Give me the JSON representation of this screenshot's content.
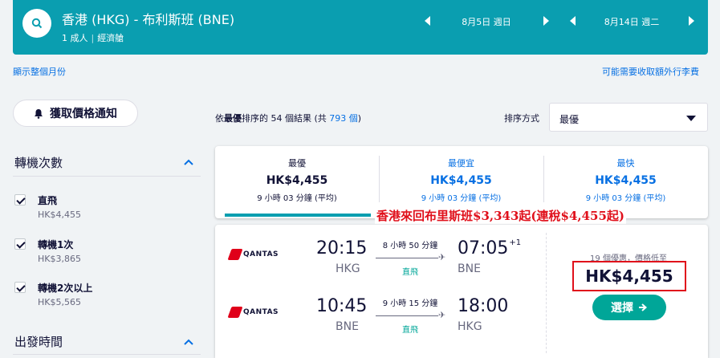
{
  "header": {
    "route": "香港 (HKG) - 布利斯班 (BNE)",
    "passengers": "1 成人",
    "cabin": "經濟艙",
    "depart_date": "8月5日 週日",
    "return_date": "8月14日 週二"
  },
  "links": {
    "show_month": "顯示整個月份",
    "baggage": "可能需要收取額外行李費"
  },
  "sidebar": {
    "price_alert": "獲取價格通知",
    "stops_title": "轉機次數",
    "stops": [
      {
        "label": "直飛",
        "price": "HK$4,455"
      },
      {
        "label": "轉機1次",
        "price": "HK$3,865"
      },
      {
        "label": "轉機2次以上",
        "price": "HK$5,565"
      }
    ],
    "depart_title": "出發時間"
  },
  "results": {
    "count_prefix": "依",
    "count_sort": "最優",
    "count_mid": "排序的 54 個結果 (共 ",
    "count_total": "793 個",
    "count_suffix": ")",
    "sort_label": "排序方式",
    "sort_value": "最優"
  },
  "tabs": [
    {
      "title": "最優",
      "price": "HK$4,455",
      "duration": "9 小時 03 分鐘 (平均)"
    },
    {
      "title": "最便宜",
      "price": "HK$4,455",
      "duration": "9 小時 03 分鐘 (平均)"
    },
    {
      "title": "最快",
      "price": "HK$4,455",
      "duration": "9 小時 03 分鐘 (平均)"
    }
  ],
  "annotation": "香港來回布里斯班$3,343起(連稅$4,455起)",
  "itinerary": {
    "airline": "QANTAS",
    "outbound": {
      "dep_time": "20:15",
      "dep_airport": "HKG",
      "duration": "8 小時 50 分鐘",
      "stops": "直飛",
      "arr_time": "07:05",
      "day_offset": "+1",
      "arr_airport": "BNE"
    },
    "inbound": {
      "dep_time": "10:45",
      "dep_airport": "BNE",
      "duration": "9 小時 15 分鐘",
      "stops": "直飛",
      "arr_time": "18:00",
      "arr_airport": "HKG"
    },
    "deals": "19 個優惠，價格低至",
    "price": "HK$4,455",
    "select": "選擇"
  },
  "colors": {
    "header": "#0a9eb0",
    "link": "#0770e3",
    "green": "#00a698",
    "annotation": "#e0101b"
  }
}
